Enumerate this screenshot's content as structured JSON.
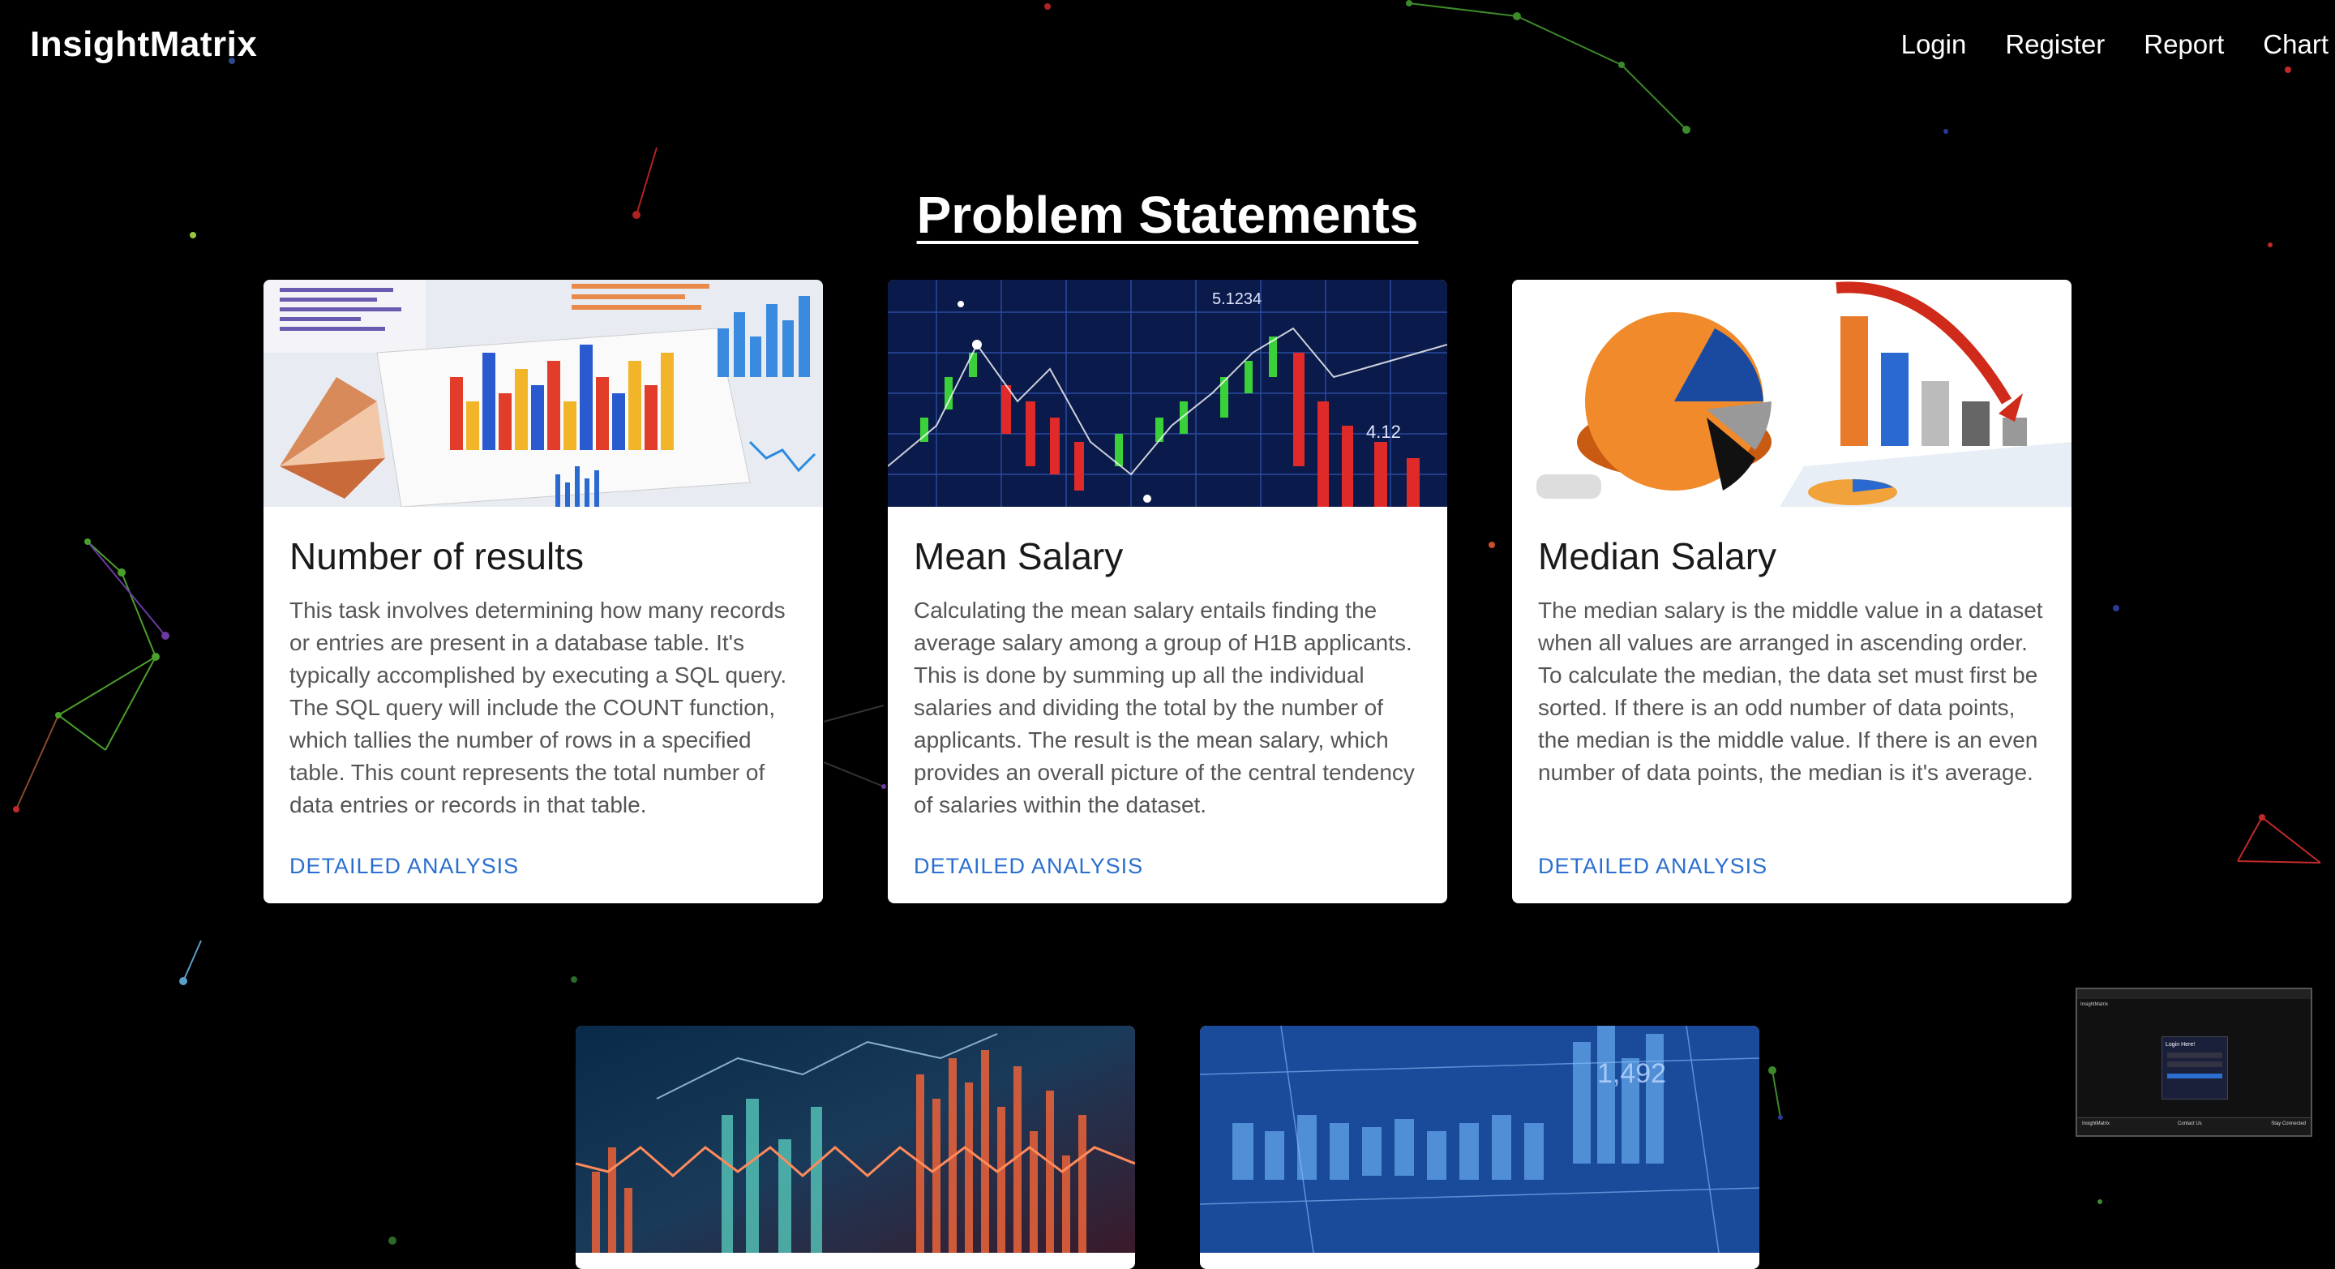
{
  "nav": {
    "brand": "InsightMatrix",
    "links": [
      "Login",
      "Register",
      "Report",
      "Chart"
    ]
  },
  "page": {
    "title": "Problem Statements"
  },
  "cards": [
    {
      "title": "Number of results",
      "text": "This task involves determining how many records or entries are present in a database table. It's typically accomplished by executing a SQL query. The SQL query will include the COUNT function, which tallies the number of rows in a specified table. This count represents the total number of data entries or records in that table.",
      "link": "DETAILED ANALYSIS",
      "image": "bar-charts-on-paper-image"
    },
    {
      "title": "Mean Salary",
      "text": "Calculating the mean salary entails finding the average salary among a group of H1B applicants. This is done by summing up all the individual salaries and dividing the total by the number of applicants. The result is the mean salary, which provides an overall picture of the central tendency of salaries within the dataset.",
      "link": "DETAILED ANALYSIS",
      "image": "stock-candlestick-chart-image",
      "image_labels": [
        "5.1234",
        "4.12"
      ]
    },
    {
      "title": "Median Salary",
      "text": "The median salary is the middle value in a dataset when all values are arranged in ascending order. To calculate the median, the data set must first be sorted. If there is an odd number of data points, the median is the middle value. If there is an even number of data points, the median is it's average.",
      "link": "DETAILED ANALYSIS",
      "image": "3d-pie-and-bar-chart-image"
    },
    {
      "image": "financial-graph-abstract-image"
    },
    {
      "image": "blue-stock-bars-image",
      "image_labels": [
        "1,492"
      ]
    }
  ],
  "thumbnail": {
    "heading": "Login Here!",
    "brand": "InsightMatrix",
    "contact": "Contact Us",
    "social": "Stay Connected"
  },
  "colors": {
    "background": "#000000",
    "link": "#2a6fd0",
    "card": "#ffffff"
  }
}
